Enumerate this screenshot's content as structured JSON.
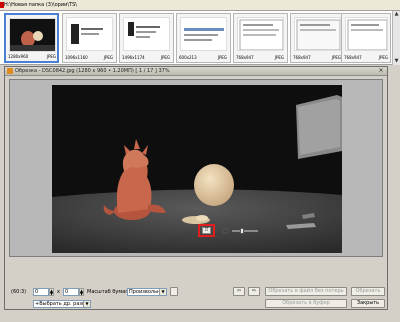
{
  "path_bar": {
    "text": "H:\\Новая папка (3)\\ории\\TS\\"
  },
  "thumbnails": [
    {
      "size": "1280x960",
      "format": "JPEG",
      "selected": true
    },
    {
      "size": "1096x1160",
      "format": "JPEG",
      "selected": false
    },
    {
      "size": "1496x1174",
      "format": "JPEG",
      "selected": false
    },
    {
      "size": "600x213",
      "format": "JPEG",
      "selected": false
    },
    {
      "size": "768x947",
      "format": "JPEG",
      "selected": false
    },
    {
      "size": "768x947",
      "format": "JPEG",
      "selected": false
    },
    {
      "size": "768x947",
      "format": "JPEG",
      "selected": false
    }
  ],
  "viewer": {
    "title": "Обрезка - DSC0842.jpg (1280 x 960 • 1.20МП) [ 1 / 17 ]  37%",
    "close_glyph": "×",
    "colors": {
      "photo_bg": "#101010",
      "frame_bg": "#b8b8b8",
      "highlight": "#e02020"
    }
  },
  "controls": {
    "ratio_label": "(60:3)",
    "width_value": "0",
    "x_label": "x",
    "height_value": "0",
    "scale_label": "Масштаб бумаги:",
    "scale_value": "Произвольно",
    "format_value": "+Выбрать др. разм",
    "prev_arrow": "⇦",
    "next_arrow": "⇨",
    "crop_to_file_label": "Обрезать в файл без потерь",
    "crop_label": "Обрезать",
    "crop_to_buffer_label": "Обрезать в буфер",
    "close_label": "Закрыть",
    "grid_glyph": "⠿"
  }
}
